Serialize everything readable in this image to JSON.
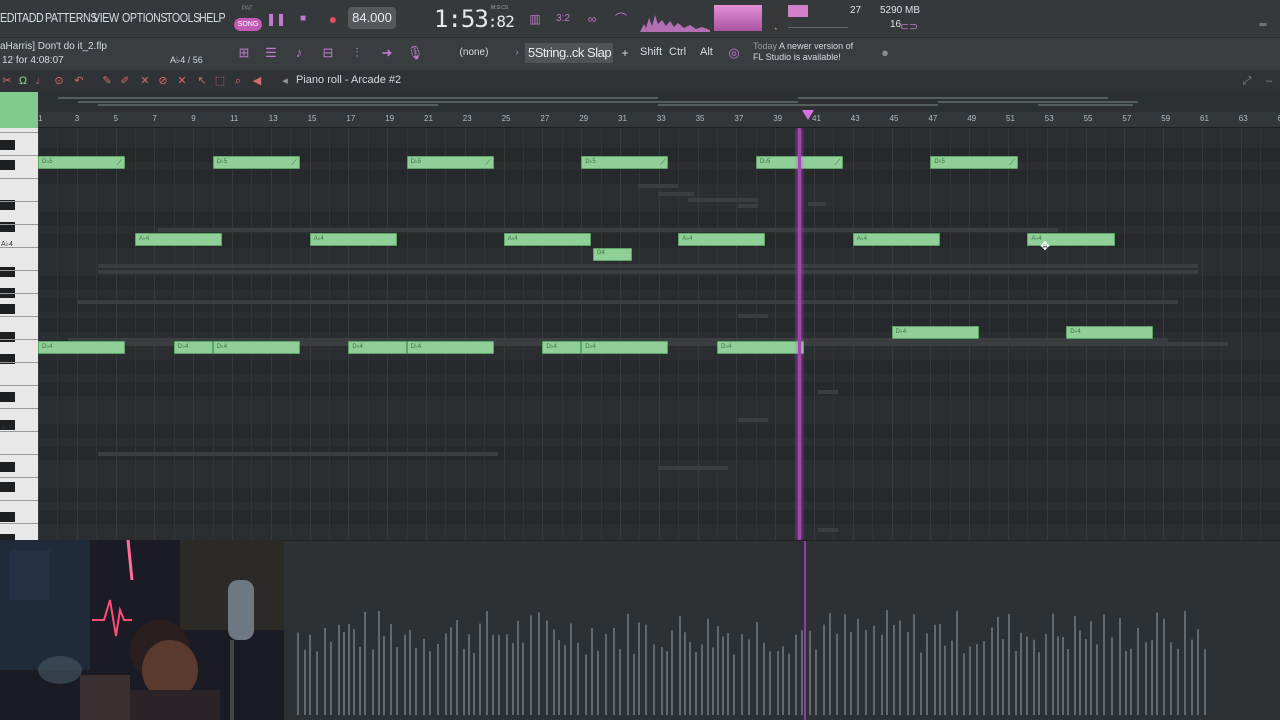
{
  "menu": {
    "items": [
      "EDIT",
      "ADD",
      "PATTERNS",
      "VIEW",
      "OPTIONS",
      "TOOLS",
      "HELP"
    ]
  },
  "transport": {
    "pat_label": "PAT",
    "song_label": "SONG",
    "tempo": "84.000",
    "time_main": "1:53",
    "time_sub": ":82",
    "time_unit": "M:S:CS"
  },
  "stats": {
    "cpu": "27",
    "memory": "5290 MB",
    "polyphony": "16"
  },
  "hint": {
    "line1": "aHarris] Don't do it_2.flp",
    "line2": "12 for 4:08:07",
    "note_info": "A♭4 / 56"
  },
  "toolbar2": {
    "pattern_select": "(none)",
    "preset": "5String..ck Slap",
    "shift": "Shift",
    "ctrl": "Ctrl",
    "alt": "Alt",
    "news_when": "Today",
    "news_text1": "A newer version of",
    "news_text2": "FL Studio is available!"
  },
  "piano_roll": {
    "title": "Piano roll - Arcade #2",
    "bar_numbers": [
      "3",
      "5",
      "7",
      "9",
      "11",
      "13",
      "15",
      "17",
      "19",
      "21",
      "23",
      "25",
      "27",
      "29",
      "31",
      "33",
      "35",
      "37",
      "39",
      "41",
      "43",
      "45",
      "47",
      "49",
      "51",
      "53",
      "55",
      "57",
      "59",
      "61",
      "63",
      "65"
    ],
    "keys": [
      {
        "label": "A♭4"
      },
      {
        "label": "A♭3"
      }
    ],
    "notes": [
      {
        "label": "D♭5",
        "bar": 1,
        "len": 4.5,
        "row": "db5"
      },
      {
        "label": "D♭5",
        "bar": 10,
        "len": 4.5,
        "row": "db5"
      },
      {
        "label": "D♭5",
        "bar": 20,
        "len": 4.5,
        "row": "db5"
      },
      {
        "label": "D♭5",
        "bar": 29,
        "len": 4.5,
        "row": "db5"
      },
      {
        "label": "D♭5",
        "bar": 38,
        "len": 4.5,
        "row": "db5"
      },
      {
        "label": "D♭5",
        "bar": 47,
        "len": 4.5,
        "row": "db5"
      },
      {
        "label": "A♭4",
        "bar": 6,
        "len": 4.5,
        "row": "ab4"
      },
      {
        "label": "A♭4",
        "bar": 15,
        "len": 4.5,
        "row": "ab4"
      },
      {
        "label": "A♭4",
        "bar": 25,
        "len": 4.5,
        "row": "ab4"
      },
      {
        "label": "A♭4",
        "bar": 34,
        "len": 4.5,
        "row": "ab4"
      },
      {
        "label": "A♭4",
        "bar": 43,
        "len": 4.5,
        "row": "ab4"
      },
      {
        "label": "A♭4",
        "bar": 52,
        "len": 4.5,
        "row": "ab4"
      },
      {
        "label": "G4",
        "bar": 29.6,
        "len": 2,
        "row": "g4"
      },
      {
        "label": "D♭4",
        "bar": 1,
        "len": 4.5,
        "row": "db4"
      },
      {
        "label": "D♭4",
        "bar": 8,
        "len": 2,
        "row": "db4"
      },
      {
        "label": "D♭4",
        "bar": 10,
        "len": 4.5,
        "row": "db4"
      },
      {
        "label": "D♭4",
        "bar": 17,
        "len": 3,
        "row": "db4"
      },
      {
        "label": "D♭4",
        "bar": 20,
        "len": 4.5,
        "row": "db4"
      },
      {
        "label": "D♭4",
        "bar": 27,
        "len": 2,
        "row": "db4"
      },
      {
        "label": "D♭4",
        "bar": 29,
        "len": 4.5,
        "row": "db4"
      },
      {
        "label": "D♭4",
        "bar": 36,
        "len": 4.5,
        "row": "db4"
      },
      {
        "label": "D♭4",
        "bar": 45,
        "len": 4.5,
        "row": "d4"
      },
      {
        "label": "D♭4",
        "bar": 54,
        "len": 4.5,
        "row": "d4"
      }
    ],
    "playhead_bar": 40.2
  },
  "colors": {
    "note_fill": "#90cf97",
    "playhead": "#a246b4",
    "accent": "#c07bd0"
  },
  "icons": [
    "pencil-icon",
    "brush-icon",
    "delete-icon",
    "mute-icon",
    "slice-icon",
    "select-icon",
    "zoom-icon",
    "playback-icon",
    "magnet-icon",
    "stamp-icon"
  ]
}
